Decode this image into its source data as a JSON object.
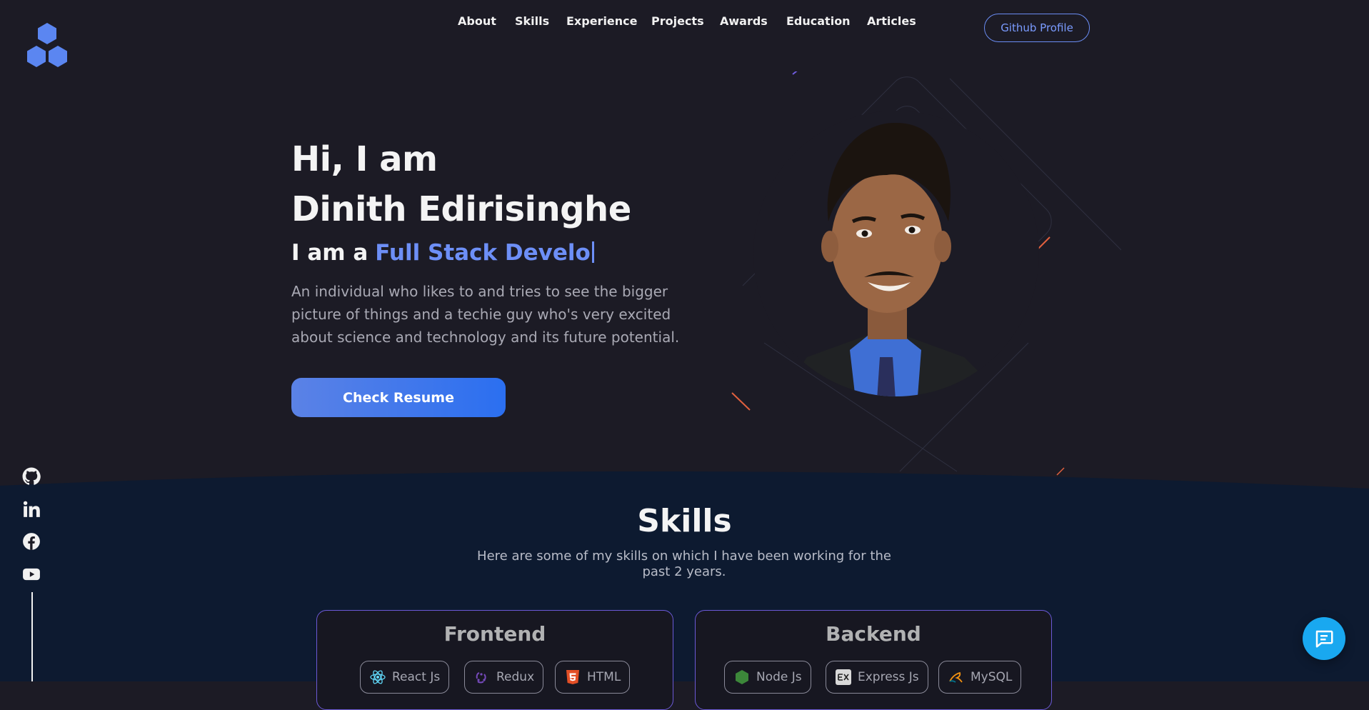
{
  "nav": {
    "items": [
      {
        "label": "About"
      },
      {
        "label": "Skills"
      },
      {
        "label": "Experience"
      },
      {
        "label": "Projects"
      },
      {
        "label": "Awards"
      },
      {
        "label": "Education"
      },
      {
        "label": "Articles"
      }
    ],
    "github_label": "Github Profile"
  },
  "logo": {
    "icon": "hexagon-cluster-icon",
    "color": "#5b86f1"
  },
  "hero": {
    "greeting": "Hi, I am",
    "name": "Dinith Edirisinghe",
    "role_prefix": "I am a",
    "role_typed": "Full Stack Develo",
    "description": "An individual who likes to and tries to see the bigger picture of things and a techie guy who's very excited about science and technology and its future potential.",
    "cta": "Check Resume",
    "portrait": "profile-photo"
  },
  "social": {
    "icons": [
      "github-icon",
      "linkedin-icon",
      "facebook-icon",
      "youtube-icon"
    ]
  },
  "skills": {
    "title": "Skills",
    "subtitle": "Here are some of my skills on which I have been working for the past 2 years.",
    "cards": [
      {
        "title": "Frontend",
        "items": [
          {
            "label": "React Js",
            "icon": "react-icon"
          },
          {
            "label": "Redux",
            "icon": "redux-icon"
          },
          {
            "label": "HTML",
            "icon": "html5-icon"
          }
        ]
      },
      {
        "title": "Backend",
        "items": [
          {
            "label": "Node Js",
            "icon": "nodejs-icon"
          },
          {
            "label": "Express Js",
            "icon": "express-icon"
          },
          {
            "label": "MySQL",
            "icon": "mysql-icon"
          }
        ]
      }
    ]
  },
  "chat": {
    "icon": "chat-bubble-icon"
  },
  "colors": {
    "background": "#1c1b25",
    "accent": "#6d8ff7",
    "skills_background": "#0d1a30",
    "chat": "#19a8f0"
  }
}
